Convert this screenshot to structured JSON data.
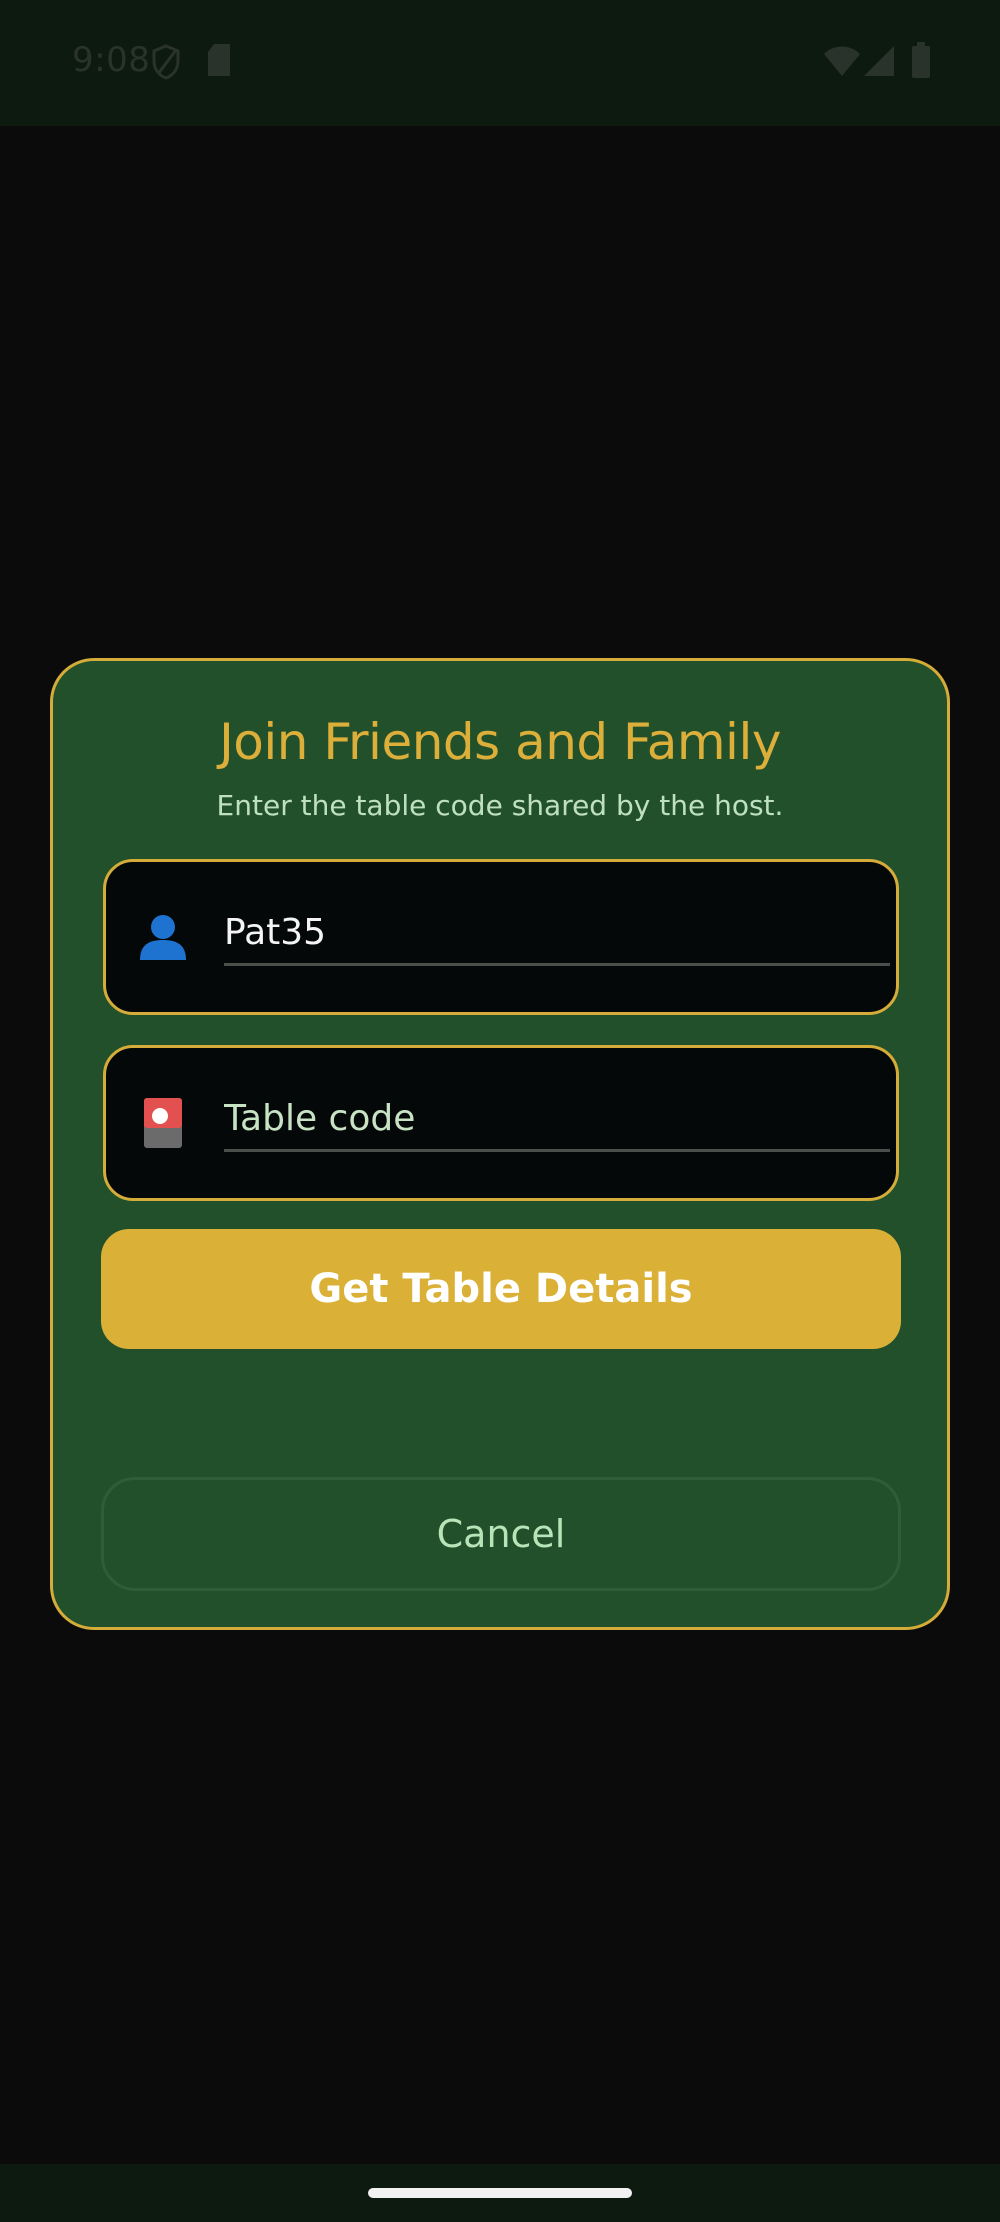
{
  "status_bar": {
    "time": "9:08",
    "icons": [
      "shield-icon",
      "sd-card-icon",
      "wifi-icon",
      "cell-signal-icon",
      "battery-icon"
    ]
  },
  "dialog": {
    "title": "Join Friends and Family",
    "subtitle": "Enter the table code shared by the host.",
    "name_field": {
      "icon": "user-icon",
      "value": "Pat35"
    },
    "code_field": {
      "icon": "playing-card-icon",
      "placeholder": "Table code",
      "value": ""
    },
    "primary_button_label": "Get Table Details",
    "cancel_button_label": "Cancel"
  },
  "colors": {
    "accent": "#dab136",
    "dialog_background": "#21502b",
    "screen_background": "#0b0b0b",
    "subtitle_text": "#bfe0bf"
  }
}
